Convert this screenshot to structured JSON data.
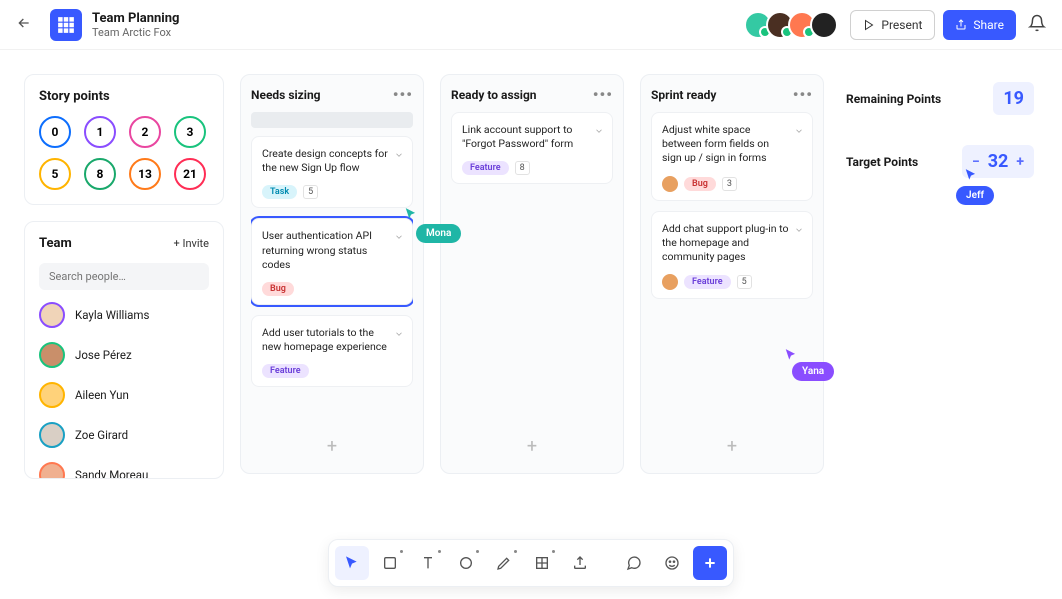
{
  "header": {
    "title": "Team Planning",
    "subtitle": "Team Arctic Fox",
    "present": "Present",
    "share": "Share"
  },
  "avatars": [
    {
      "bg": "#34c9a3",
      "online": true
    },
    {
      "bg": "#4a2f22",
      "online": true
    },
    {
      "bg": "#ff7850",
      "online": true
    },
    {
      "bg": "#222",
      "online": false
    }
  ],
  "storypoints": {
    "title": "Story points",
    "values": [
      {
        "v": "0",
        "c": "#0d6efd"
      },
      {
        "v": "1",
        "c": "#8a4dff"
      },
      {
        "v": "2",
        "c": "#e946a0"
      },
      {
        "v": "3",
        "c": "#19c37d"
      },
      {
        "v": "5",
        "c": "#ffb400"
      },
      {
        "v": "8",
        "c": "#19a86b"
      },
      {
        "v": "13",
        "c": "#ff7a1a"
      },
      {
        "v": "21",
        "c": "#ff2d55"
      }
    ]
  },
  "team": {
    "title": "Team",
    "invite": "+ Invite",
    "search_ph": "Search people…",
    "members": [
      {
        "name": "Kayla Williams",
        "ring": "#8a4dff",
        "bg": "#f0d4b8"
      },
      {
        "name": "Jose Pérez",
        "ring": "#19c37d",
        "bg": "#c98f6a"
      },
      {
        "name": "Aileen Yun",
        "ring": "#ffb400",
        "bg": "#ffd27a"
      },
      {
        "name": "Zoe Girard",
        "ring": "#19a0c3",
        "bg": "#d9cfc5"
      },
      {
        "name": "Sandy Moreau",
        "ring": "#ff7850",
        "bg": "#f0b090"
      }
    ]
  },
  "columns": [
    {
      "title": "Needs sizing",
      "placeholder": true,
      "cards": [
        {
          "text": "Create design concepts for the new Sign Up flow",
          "type": "task",
          "type_label": "Task",
          "points": "5"
        },
        {
          "text": "User authentication API returning wrong status codes",
          "type": "bug",
          "type_label": "Bug",
          "selected": true
        },
        {
          "text": "Add user tutorials to the new homepage experience",
          "type": "feature",
          "type_label": "Feature"
        }
      ]
    },
    {
      "title": "Ready to assign",
      "cards": [
        {
          "text": "Link account support to \"Forgot Password\" form",
          "type": "feature",
          "type_label": "Feature",
          "points": "8"
        }
      ]
    },
    {
      "title": "Sprint ready",
      "cards": [
        {
          "text": "Adjust white space between form fields on sign up / sign in forms",
          "type": "bug",
          "type_label": "Bug",
          "points": "3",
          "avatar": true
        },
        {
          "text": "Add chat support plug-in to the homepage and community pages",
          "type": "feature",
          "type_label": "Feature",
          "points": "5",
          "avatar": true
        }
      ]
    }
  ],
  "stats": {
    "remaining_label": "Remaining Points",
    "remaining_value": "19",
    "target_label": "Target Points",
    "target_value": "32"
  },
  "cursors": {
    "mona": "Mona",
    "yana": "Yana",
    "jeff": "Jeff"
  },
  "add_glyph": "+",
  "minus_glyph": "−",
  "plus_glyph": "+"
}
